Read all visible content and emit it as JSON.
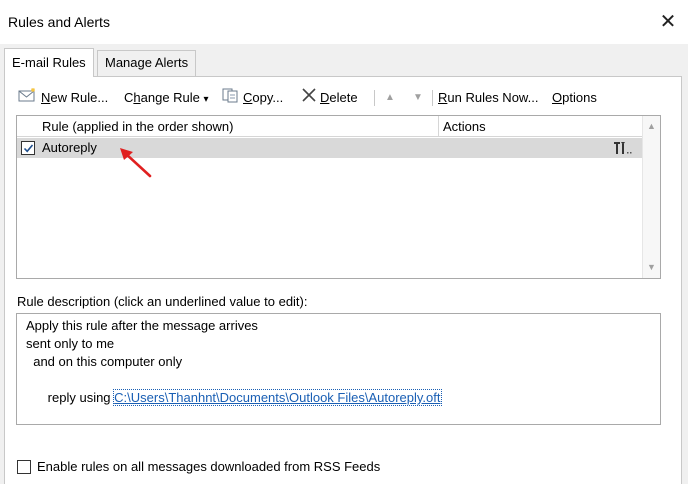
{
  "window": {
    "title": "Rules and Alerts",
    "close_glyph": "✕"
  },
  "tabs": [
    {
      "label": "E-mail Rules",
      "active": true
    },
    {
      "label": "Manage Alerts",
      "active": false
    }
  ],
  "toolbar": {
    "new_rule": {
      "accel": "N",
      "rest": "ew Rule..."
    },
    "change_rule": {
      "accel": "h",
      "pre": "C",
      "rest": "ange Rule",
      "dropdown": "▾"
    },
    "copy": {
      "accel": "C",
      "rest": "opy..."
    },
    "delete": {
      "accel": "D",
      "rest": "elete"
    },
    "move_up": "▲",
    "move_down": "▼",
    "run_rules": {
      "accel": "R",
      "rest": "un Rules Now..."
    },
    "options": {
      "accel": "O",
      "rest": "ptions"
    }
  },
  "rules_list": {
    "columns": {
      "rule": "Rule (applied in the order shown)",
      "actions": "Actions"
    },
    "rows": [
      {
        "name": "Autoreply",
        "checked": true,
        "selected": true,
        "action_icon": "rule-actions-icon"
      }
    ],
    "scroll_up": "▲",
    "scroll_down": "▼"
  },
  "description": {
    "label": "Rule description (click an underlined value to edit):",
    "lines": {
      "line1": "Apply this rule after the message arrives",
      "line2": "sent only to me",
      "line3": "  and on this computer only",
      "line4_prefix": "reply using ",
      "line4_link": "C:\\Users\\Thanhnt\\Documents\\Outlook Files\\Autoreply.oft"
    }
  },
  "rss": {
    "label": "Enable rules on all messages downloaded from RSS Feeds",
    "checked": false
  },
  "colors": {
    "accent_link": "#1a5fb4",
    "selected_row": "#d9d9d9",
    "annotation": "#e02020"
  }
}
